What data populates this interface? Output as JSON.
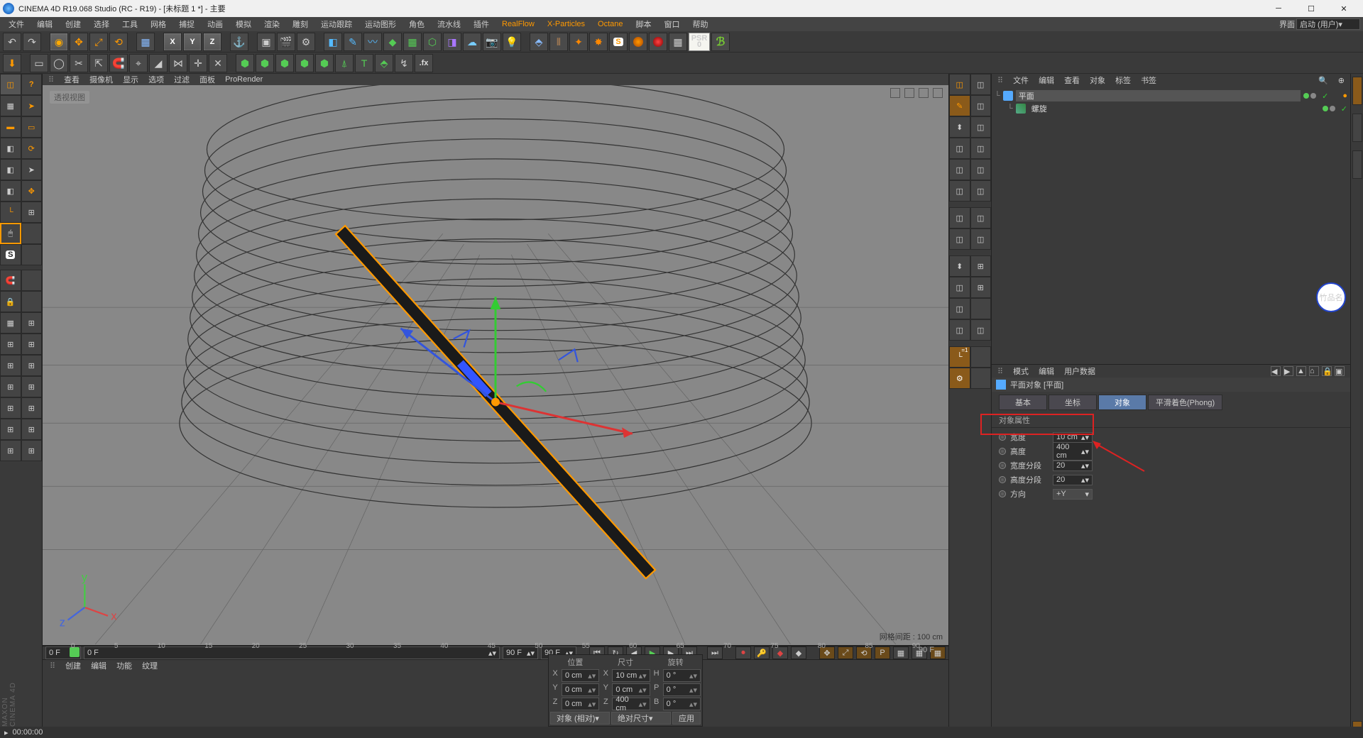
{
  "title": "CINEMA 4D R19.068 Studio (RC - R19) - [未标题 1 *] - 主要",
  "menus": [
    "文件",
    "编辑",
    "创建",
    "选择",
    "工具",
    "网格",
    "捕捉",
    "动画",
    "模拟",
    "渲染",
    "雕刻",
    "运动跟踪",
    "运动图形",
    "角色",
    "流水线",
    "插件",
    "RealFlow",
    "X-Particles",
    "Octane",
    "脚本",
    "窗口",
    "帮助"
  ],
  "layout_label": "界面",
  "layout_value": "启动 (用户)",
  "highlight_menus": [
    "RealFlow",
    "X-Particles",
    "Octane"
  ],
  "viewport": {
    "tabs": [
      "查看",
      "摄像机",
      "显示",
      "选项",
      "过滤",
      "面板",
      "ProRender"
    ],
    "name": "透视视图",
    "grid_label": "网格间距 : 100 cm",
    "timeline_end": "90 F"
  },
  "timeline_ticks": [
    "0",
    "5",
    "10",
    "15",
    "20",
    "25",
    "30",
    "35",
    "40",
    "45",
    "50",
    "55",
    "60",
    "65",
    "70",
    "75",
    "80",
    "85",
    "90"
  ],
  "transport": {
    "f0": "0 F",
    "f1": "0 F",
    "f2": "90 F",
    "f3": "90 F"
  },
  "lower_menu": [
    "创建",
    "编辑",
    "功能",
    "纹理"
  ],
  "coords": {
    "hdr": [
      "位置",
      "尺寸",
      "旋转"
    ],
    "rows": [
      {
        "axis": "X",
        "pos": "0 cm",
        "size": "10 cm",
        "rot": "0 °",
        "s": "X",
        "r": "H"
      },
      {
        "axis": "Y",
        "pos": "0 cm",
        "size": "0 cm",
        "rot": "0 °",
        "s": "Y",
        "r": "P"
      },
      {
        "axis": "Z",
        "pos": "0 cm",
        "size": "400 cm",
        "rot": "0 °",
        "s": "Z",
        "r": "B"
      }
    ],
    "dd1": "对象 (相对)",
    "dd2": "绝对尺寸",
    "apply": "应用"
  },
  "obj_menu": [
    "文件",
    "编辑",
    "查看",
    "对象",
    "标签",
    "书签"
  ],
  "tree": [
    {
      "name": "平面",
      "sel": true,
      "spiral": false
    },
    {
      "name": "螺旋",
      "sel": false,
      "spiral": true
    }
  ],
  "attr_menu": [
    "模式",
    "编辑",
    "用户数据"
  ],
  "attr_title": "平面对象 [平面]",
  "attr_tabs": [
    "基本",
    "坐标",
    "对象",
    "平滑着色(Phong)"
  ],
  "attr_active_tab": "对象",
  "attr_section": "对象属性",
  "props": [
    {
      "label": "宽度",
      "value": "10 cm",
      "hl": true
    },
    {
      "label": "高度",
      "value": "400 cm"
    },
    {
      "label": "宽度分段",
      "value": "20"
    },
    {
      "label": "高度分段",
      "value": "20"
    },
    {
      "label": "方向",
      "value": "+Y",
      "dd": true
    }
  ],
  "status_time": "00:00:00",
  "watermark": "竹品名"
}
